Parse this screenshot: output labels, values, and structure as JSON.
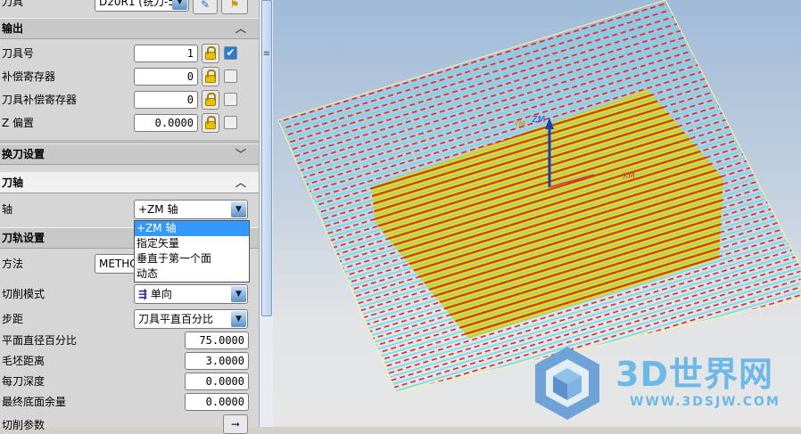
{
  "tool_row": {
    "label": "刀具",
    "tool_value": "D20R1 (铣刀-5"
  },
  "output": {
    "title": "输出",
    "rows": [
      {
        "label": "刀具号",
        "value": "1",
        "checked": true
      },
      {
        "label": "补偿寄存器",
        "value": "0",
        "checked": false
      },
      {
        "label": "刀具补偿寄存器",
        "value": "0",
        "checked": false
      },
      {
        "label": "Z 偏置",
        "value": "0.0000",
        "checked": false
      }
    ]
  },
  "tool_change": {
    "title": "换刀设置"
  },
  "tool_axis": {
    "title": "刀轴",
    "axis_label": "轴",
    "axis_value": "+ZM 轴",
    "options": [
      "+ZM 轴",
      "指定矢量",
      "垂直于第一个面",
      "动态"
    ]
  },
  "path_settings": {
    "title": "刀轨设置",
    "method_label": "方法",
    "method_value": "METHOD",
    "cut_mode_label": "切削模式",
    "cut_mode_value": "单向",
    "stepover_label": "步距",
    "stepover_value": "刀具平直百分比",
    "rows": [
      {
        "label": "平面直径百分比",
        "value": "75.0000"
      },
      {
        "label": "毛坯距离",
        "value": "3.0000"
      },
      {
        "label": "每刀深度",
        "value": "0.0000"
      },
      {
        "label": "最终底面余量",
        "value": "0.0000"
      }
    ],
    "cut_params_label": "切削参数"
  },
  "viewport": {
    "axis_labels": [
      "ZM",
      "YM",
      "XM"
    ]
  },
  "watermark": {
    "title": "3D世界网",
    "url": "WWW.3DSJW.COM"
  }
}
